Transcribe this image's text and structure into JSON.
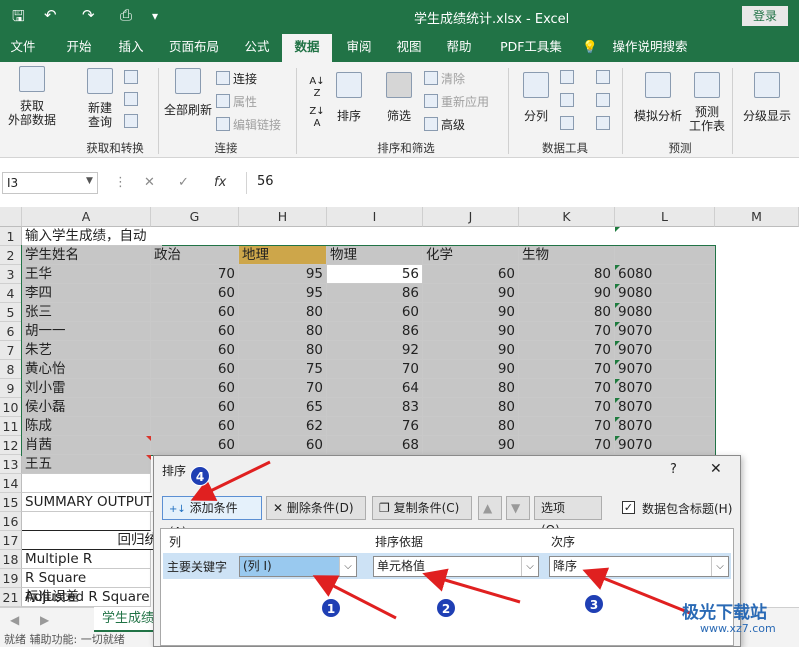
{
  "app": {
    "title": "学生成绩统计.xlsx  -  Excel",
    "login": "登录"
  },
  "tabs": [
    "文件",
    "开始",
    "插入",
    "页面布局",
    "公式",
    "数据",
    "审阅",
    "视图",
    "帮助",
    "PDF工具集",
    "操作说明搜索"
  ],
  "active_tab": "数据",
  "ribbon": {
    "get_data": "获取\n外部数据",
    "new_query": "新建\n查询",
    "group_get_transform": "获取和转换",
    "refresh_all": "全部刷新",
    "connections": "连接",
    "properties": "属性",
    "edit_links": "编辑链接",
    "group_connections": "连接",
    "sort": "排序",
    "filter": "筛选",
    "clear": "清除",
    "reapply": "重新应用",
    "advanced": "高级",
    "group_sort_filter": "排序和筛选",
    "text_to_columns": "分列",
    "group_data_tools": "数据工具",
    "what_if": "模拟分析",
    "forecast_sheet": "预测\n工作表",
    "group_forecast": "预测",
    "outline": "分级显示"
  },
  "formula_bar": {
    "name_box": "I3",
    "fx": "fx",
    "value": "56"
  },
  "columns": [
    "A",
    "G",
    "H",
    "I",
    "J",
    "K",
    "L",
    "M"
  ],
  "rows": [
    "1",
    "2",
    "3",
    "4",
    "5",
    "6",
    "7",
    "8",
    "9",
    "10",
    "11",
    "12",
    "13",
    "14",
    "15",
    "16",
    "17",
    "18",
    "19",
    "20",
    "21"
  ],
  "sheet": {
    "r1": "输入学生成绩，自动",
    "headers": [
      "学生姓名",
      "政治",
      "地理",
      "物理",
      "化学",
      "生物"
    ],
    "data": [
      [
        "王华",
        "70",
        "95",
        "56",
        "60",
        "80",
        "6080"
      ],
      [
        "李四",
        "60",
        "95",
        "86",
        "90",
        "90",
        "9080"
      ],
      [
        "张三",
        "60",
        "80",
        "60",
        "90",
        "80",
        "9080"
      ],
      [
        "胡一一",
        "60",
        "80",
        "86",
        "90",
        "70",
        "9070"
      ],
      [
        "朱艺",
        "60",
        "80",
        "92",
        "90",
        "70",
        "9070"
      ],
      [
        "黄心怡",
        "60",
        "75",
        "70",
        "90",
        "70",
        "9070"
      ],
      [
        "刘小雷",
        "60",
        "70",
        "64",
        "80",
        "70",
        "8070"
      ],
      [
        "侯小磊",
        "60",
        "65",
        "83",
        "80",
        "70",
        "8070"
      ],
      [
        "陈成",
        "60",
        "62",
        "76",
        "80",
        "70",
        "8070"
      ],
      [
        "肖茜",
        "60",
        "60",
        "68",
        "90",
        "70",
        "9070"
      ]
    ],
    "r13": "王五",
    "r15": "SUMMARY OUTPUT",
    "r17": "回归统",
    "r18": "Multiple R",
    "r19": "R Square",
    "r20": "Adjusted R Square",
    "r21": "标准误差"
  },
  "sheet_tab": "学生成绩",
  "status_text": "就绪    辅助功能: 一切就绪",
  "dialog": {
    "title": "排序",
    "help": "?",
    "close": "✕",
    "add_level": "添加条件(A)",
    "delete_level": "删除条件(D)",
    "copy_level": "复制条件(C)",
    "options": "选项(O)...",
    "has_headers": "数据包含标题(H)",
    "col_header": "列",
    "sort_on_header": "排序依据",
    "order_header": "次序",
    "primary_key_label": "主要关键字",
    "column_value": "(列 I)",
    "sort_on_value": "单元格值",
    "order_value": "降序"
  },
  "annotations": [
    "1",
    "2",
    "3",
    "4"
  ],
  "watermark": {
    "brand": "极光下载站",
    "url": "www.xz7.com"
  },
  "colors": {
    "excel_green": "#217346",
    "selection_gray": "#c6c6c6",
    "arrow_red": "#e02020",
    "badge_blue": "#1f3fb4",
    "highlight_fill": "#cda64a"
  }
}
